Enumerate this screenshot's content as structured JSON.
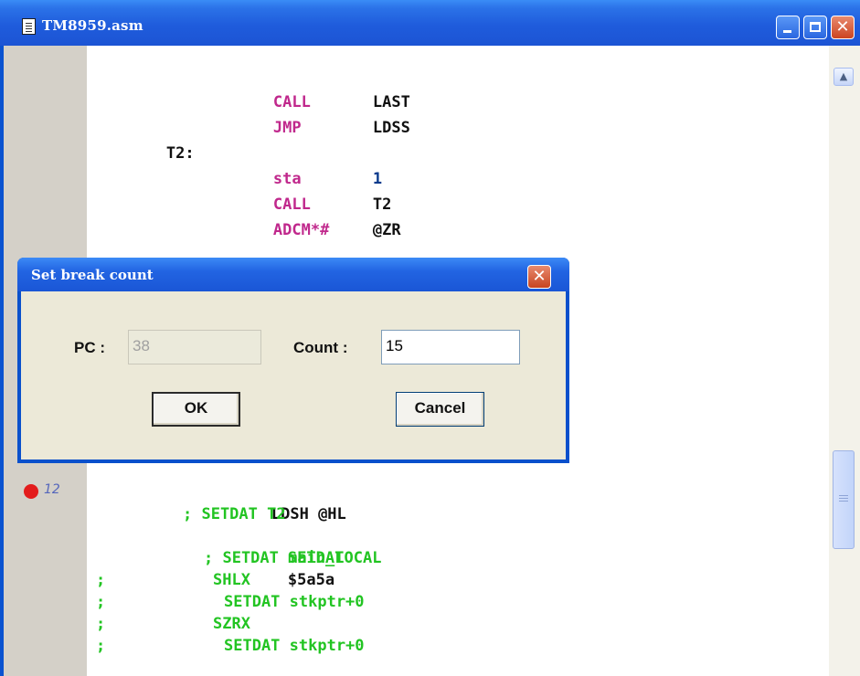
{
  "window": {
    "title": "TM8959.asm",
    "controls": {
      "minimize": "minimize",
      "maximize": "maximize",
      "close": "✕"
    }
  },
  "editor": {
    "lines": [
      {
        "label": "",
        "op": "CALL",
        "arg": "LAST"
      },
      {
        "label": "",
        "op": "JMP",
        "arg": "LDSS"
      },
      {
        "label": "T2:",
        "op": "",
        "arg": ""
      },
      {
        "label": "",
        "op": "sta",
        "arg": "1"
      },
      {
        "label": "",
        "op": "CALL",
        "arg": "T2"
      },
      {
        "label": "",
        "op": "ADCM*#",
        "arg": "@ZR"
      }
    ],
    "bottom_lines": [
      {
        "text": "LDSH @HL"
      },
      {
        "text": "; SETDAT T2"
      },
      {
        "op": "SETDAT",
        "arg": "$5a5a"
      },
      {
        "text": "; SETDAT main_LOCAL"
      },
      {
        "prefix": ";",
        "text": "SHLX"
      },
      {
        "prefix": ";",
        "text": "SETDAT stkptr+0"
      },
      {
        "prefix": ";",
        "text": "SZRX"
      },
      {
        "prefix": ";",
        "text": "SETDAT stkptr+0"
      }
    ],
    "breakpoint": {
      "line_number": "12",
      "color": "#e31c1c"
    }
  },
  "dialog": {
    "title": "Set break count",
    "close_glyph": "✕",
    "pc_label": "PC :",
    "pc_value": "38",
    "count_label": "Count :",
    "count_value": "15",
    "ok_label": "OK",
    "cancel_label": "Cancel"
  },
  "colors": {
    "titlebar": "#1f5cdc",
    "keyword": "#c0288c",
    "number": "#0a3a8c",
    "comment": "#22c422"
  }
}
